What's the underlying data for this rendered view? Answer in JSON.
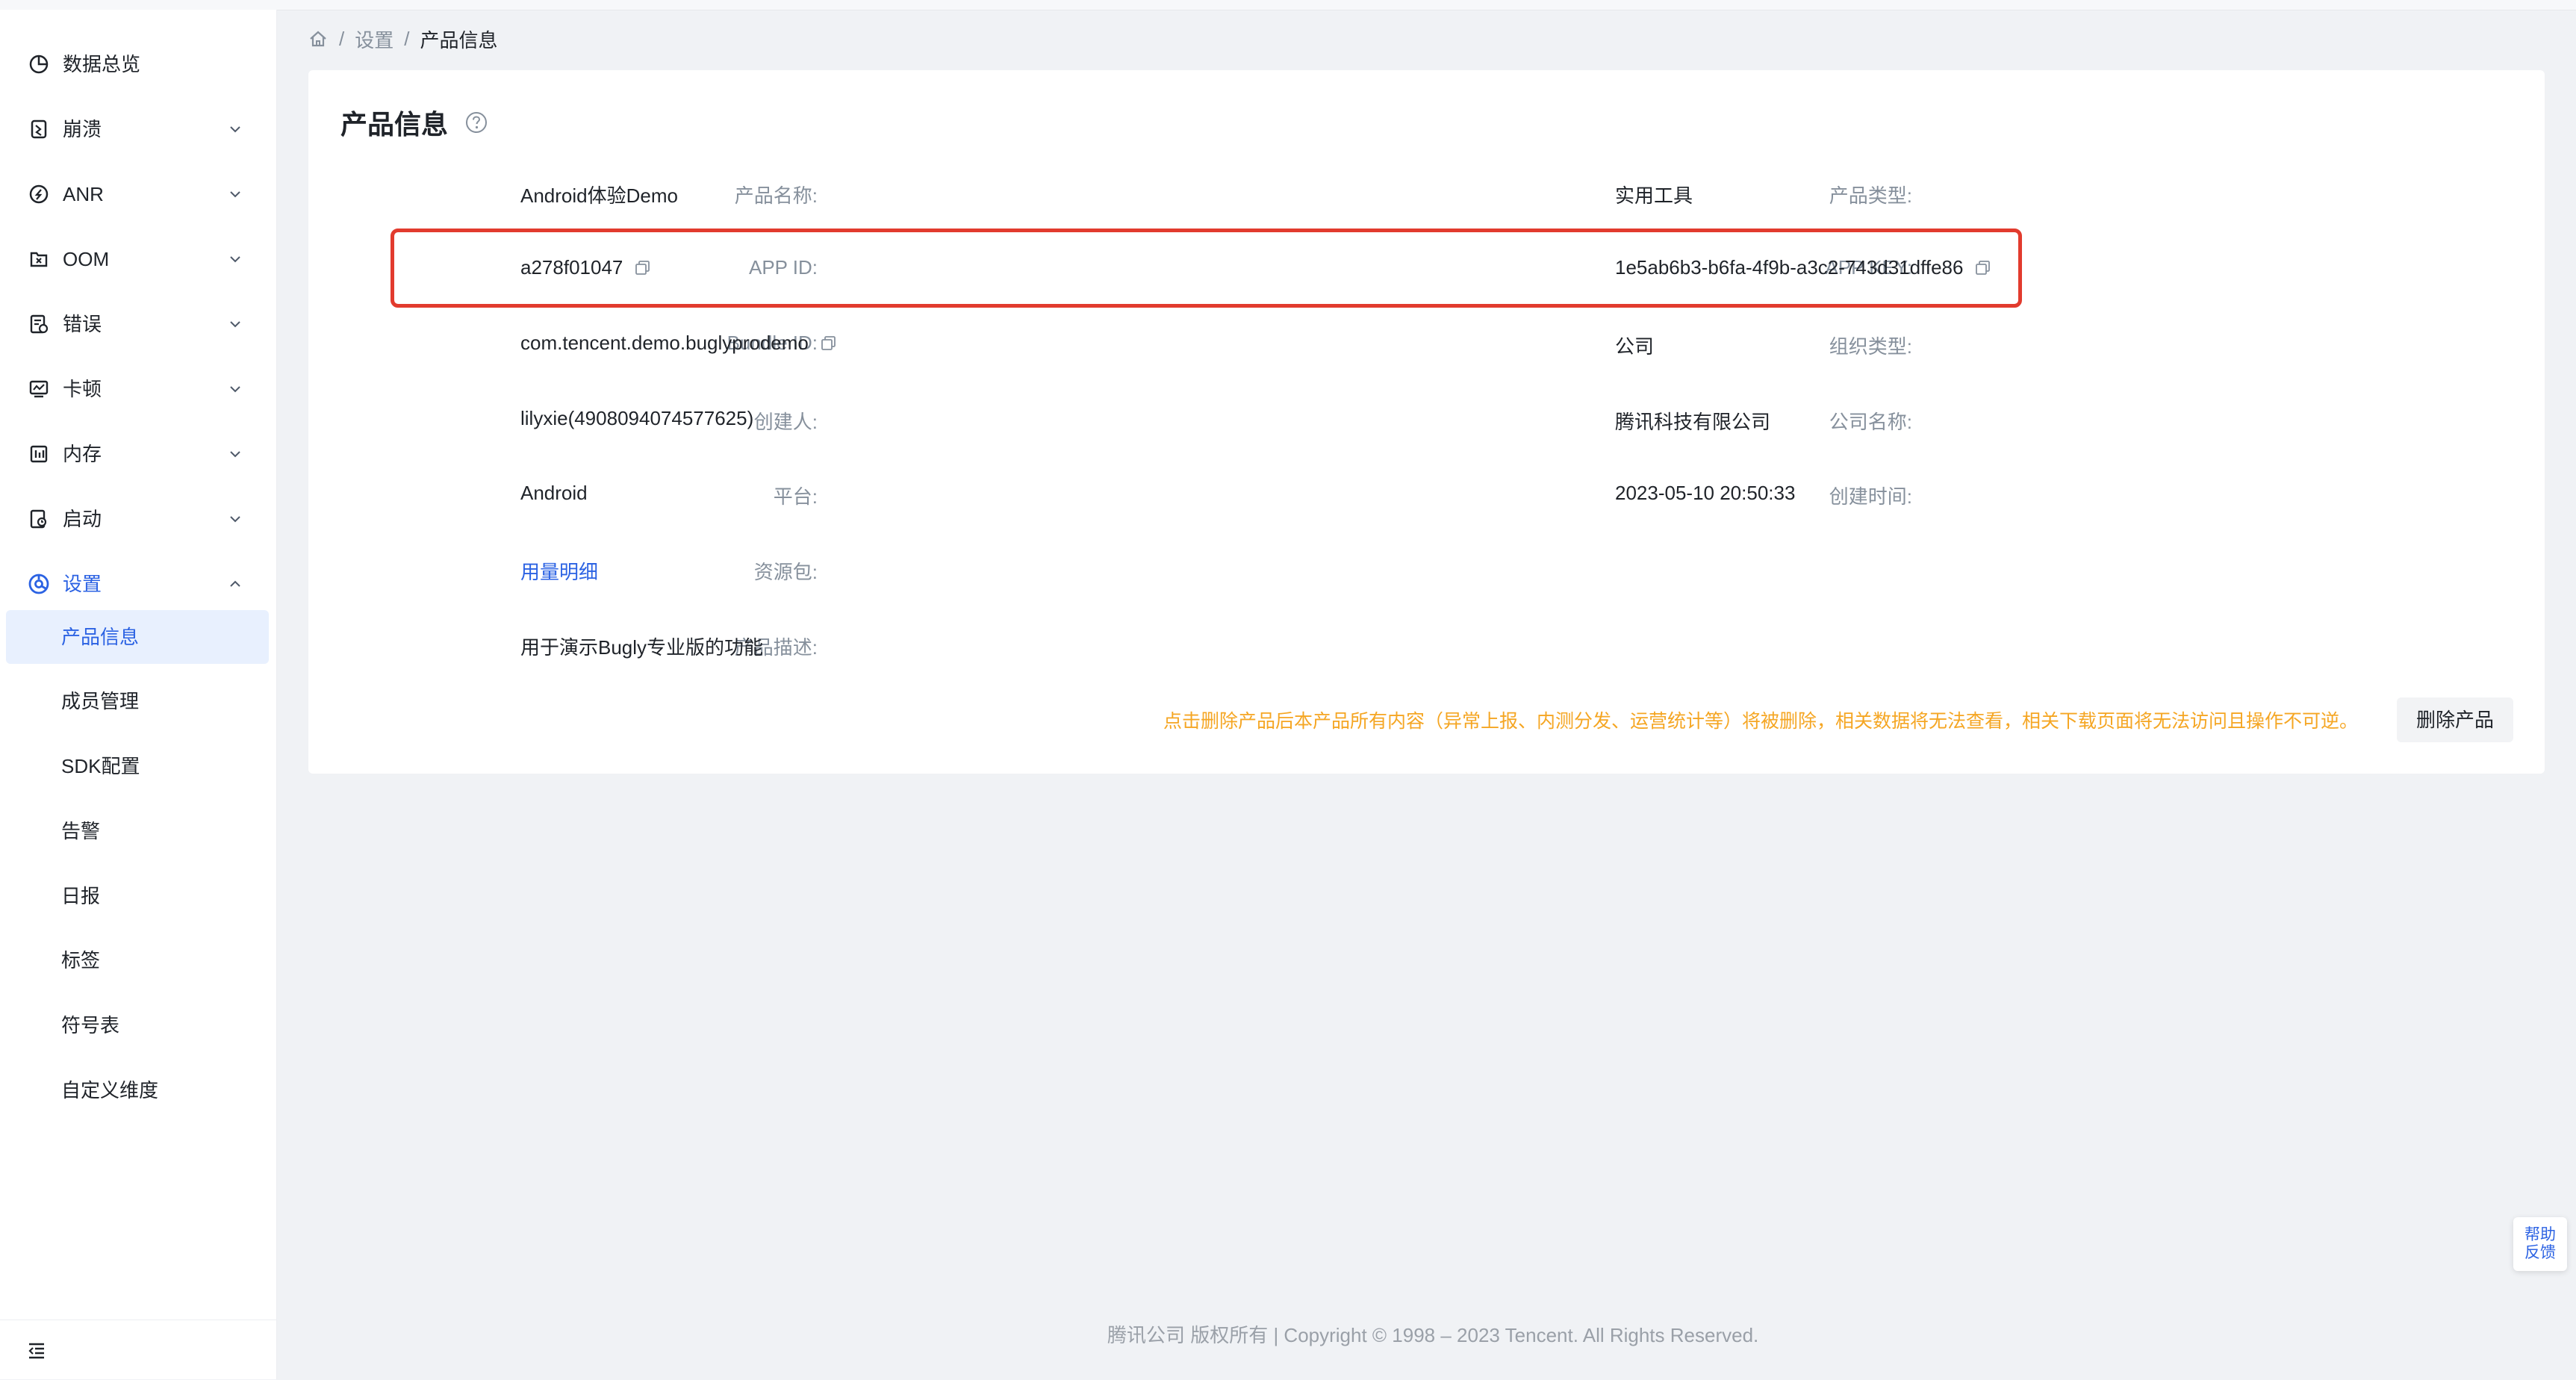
{
  "sidebar": {
    "items": [
      {
        "label": "数据总览",
        "icon": "pie-chart-icon"
      },
      {
        "label": "崩溃",
        "icon": "crash-icon"
      },
      {
        "label": "ANR",
        "icon": "anr-icon"
      },
      {
        "label": "OOM",
        "icon": "oom-icon"
      },
      {
        "label": "错误",
        "icon": "error-icon"
      },
      {
        "label": "卡顿",
        "icon": "lag-icon"
      },
      {
        "label": "内存",
        "icon": "memory-icon"
      },
      {
        "label": "启动",
        "icon": "launch-icon"
      },
      {
        "label": "设置",
        "icon": "settings-icon"
      }
    ],
    "settings_children": [
      "产品信息",
      "成员管理",
      "SDK配置",
      "告警",
      "日报",
      "标签",
      "符号表",
      "自定义维度"
    ]
  },
  "breadcrumb": {
    "level1": "设置",
    "current": "产品信息",
    "separator": "/"
  },
  "card": {
    "title": "产品信息",
    "fields": {
      "product_name": {
        "label": "产品名称:",
        "value": "Android体验Demo"
      },
      "product_type": {
        "label": "产品类型:",
        "value": "实用工具"
      },
      "app_id": {
        "label": "APP ID:",
        "value": "a278f01047"
      },
      "app_key": {
        "label": "APP KEY:",
        "value": "1e5ab6b3-b6fa-4f9b-a3c2-743d31dffe86"
      },
      "bundle_id": {
        "label": "Bundle ID:",
        "value": "com.tencent.demo.buglyprodemo"
      },
      "org_type": {
        "label": "组织类型:",
        "value": "公司"
      },
      "creator": {
        "label": "创建人:",
        "value": "lilyxie(4908094074577625)"
      },
      "company_name": {
        "label": "公司名称:",
        "value": "腾讯科技有限公司"
      },
      "platform": {
        "label": "平台:",
        "value": "Android"
      },
      "created_at": {
        "label": "创建时间:",
        "value": "2023-05-10 20:50:33"
      },
      "resource": {
        "label": "资源包:",
        "value": "用量明细"
      },
      "description": {
        "label": "产品描述:",
        "value": "用于演示Bugly专业版的功能"
      }
    },
    "warning": "点击删除产品后本产品所有内容（异常上报、内测分发、运营统计等）将被删除，相关数据将无法查看，相关下载页面将无法访问且操作不可逆。",
    "delete_button": "删除产品"
  },
  "footer": {
    "copyright": "腾讯公司 版权所有 | Copyright © 1998 – 2023 Tencent. All Rights Reserved."
  },
  "feedback": {
    "line1": "帮助",
    "line2": "反馈"
  },
  "colors": {
    "accent": "#2b62e3",
    "warning": "#f5a623",
    "highlight": "#e23b2e"
  }
}
